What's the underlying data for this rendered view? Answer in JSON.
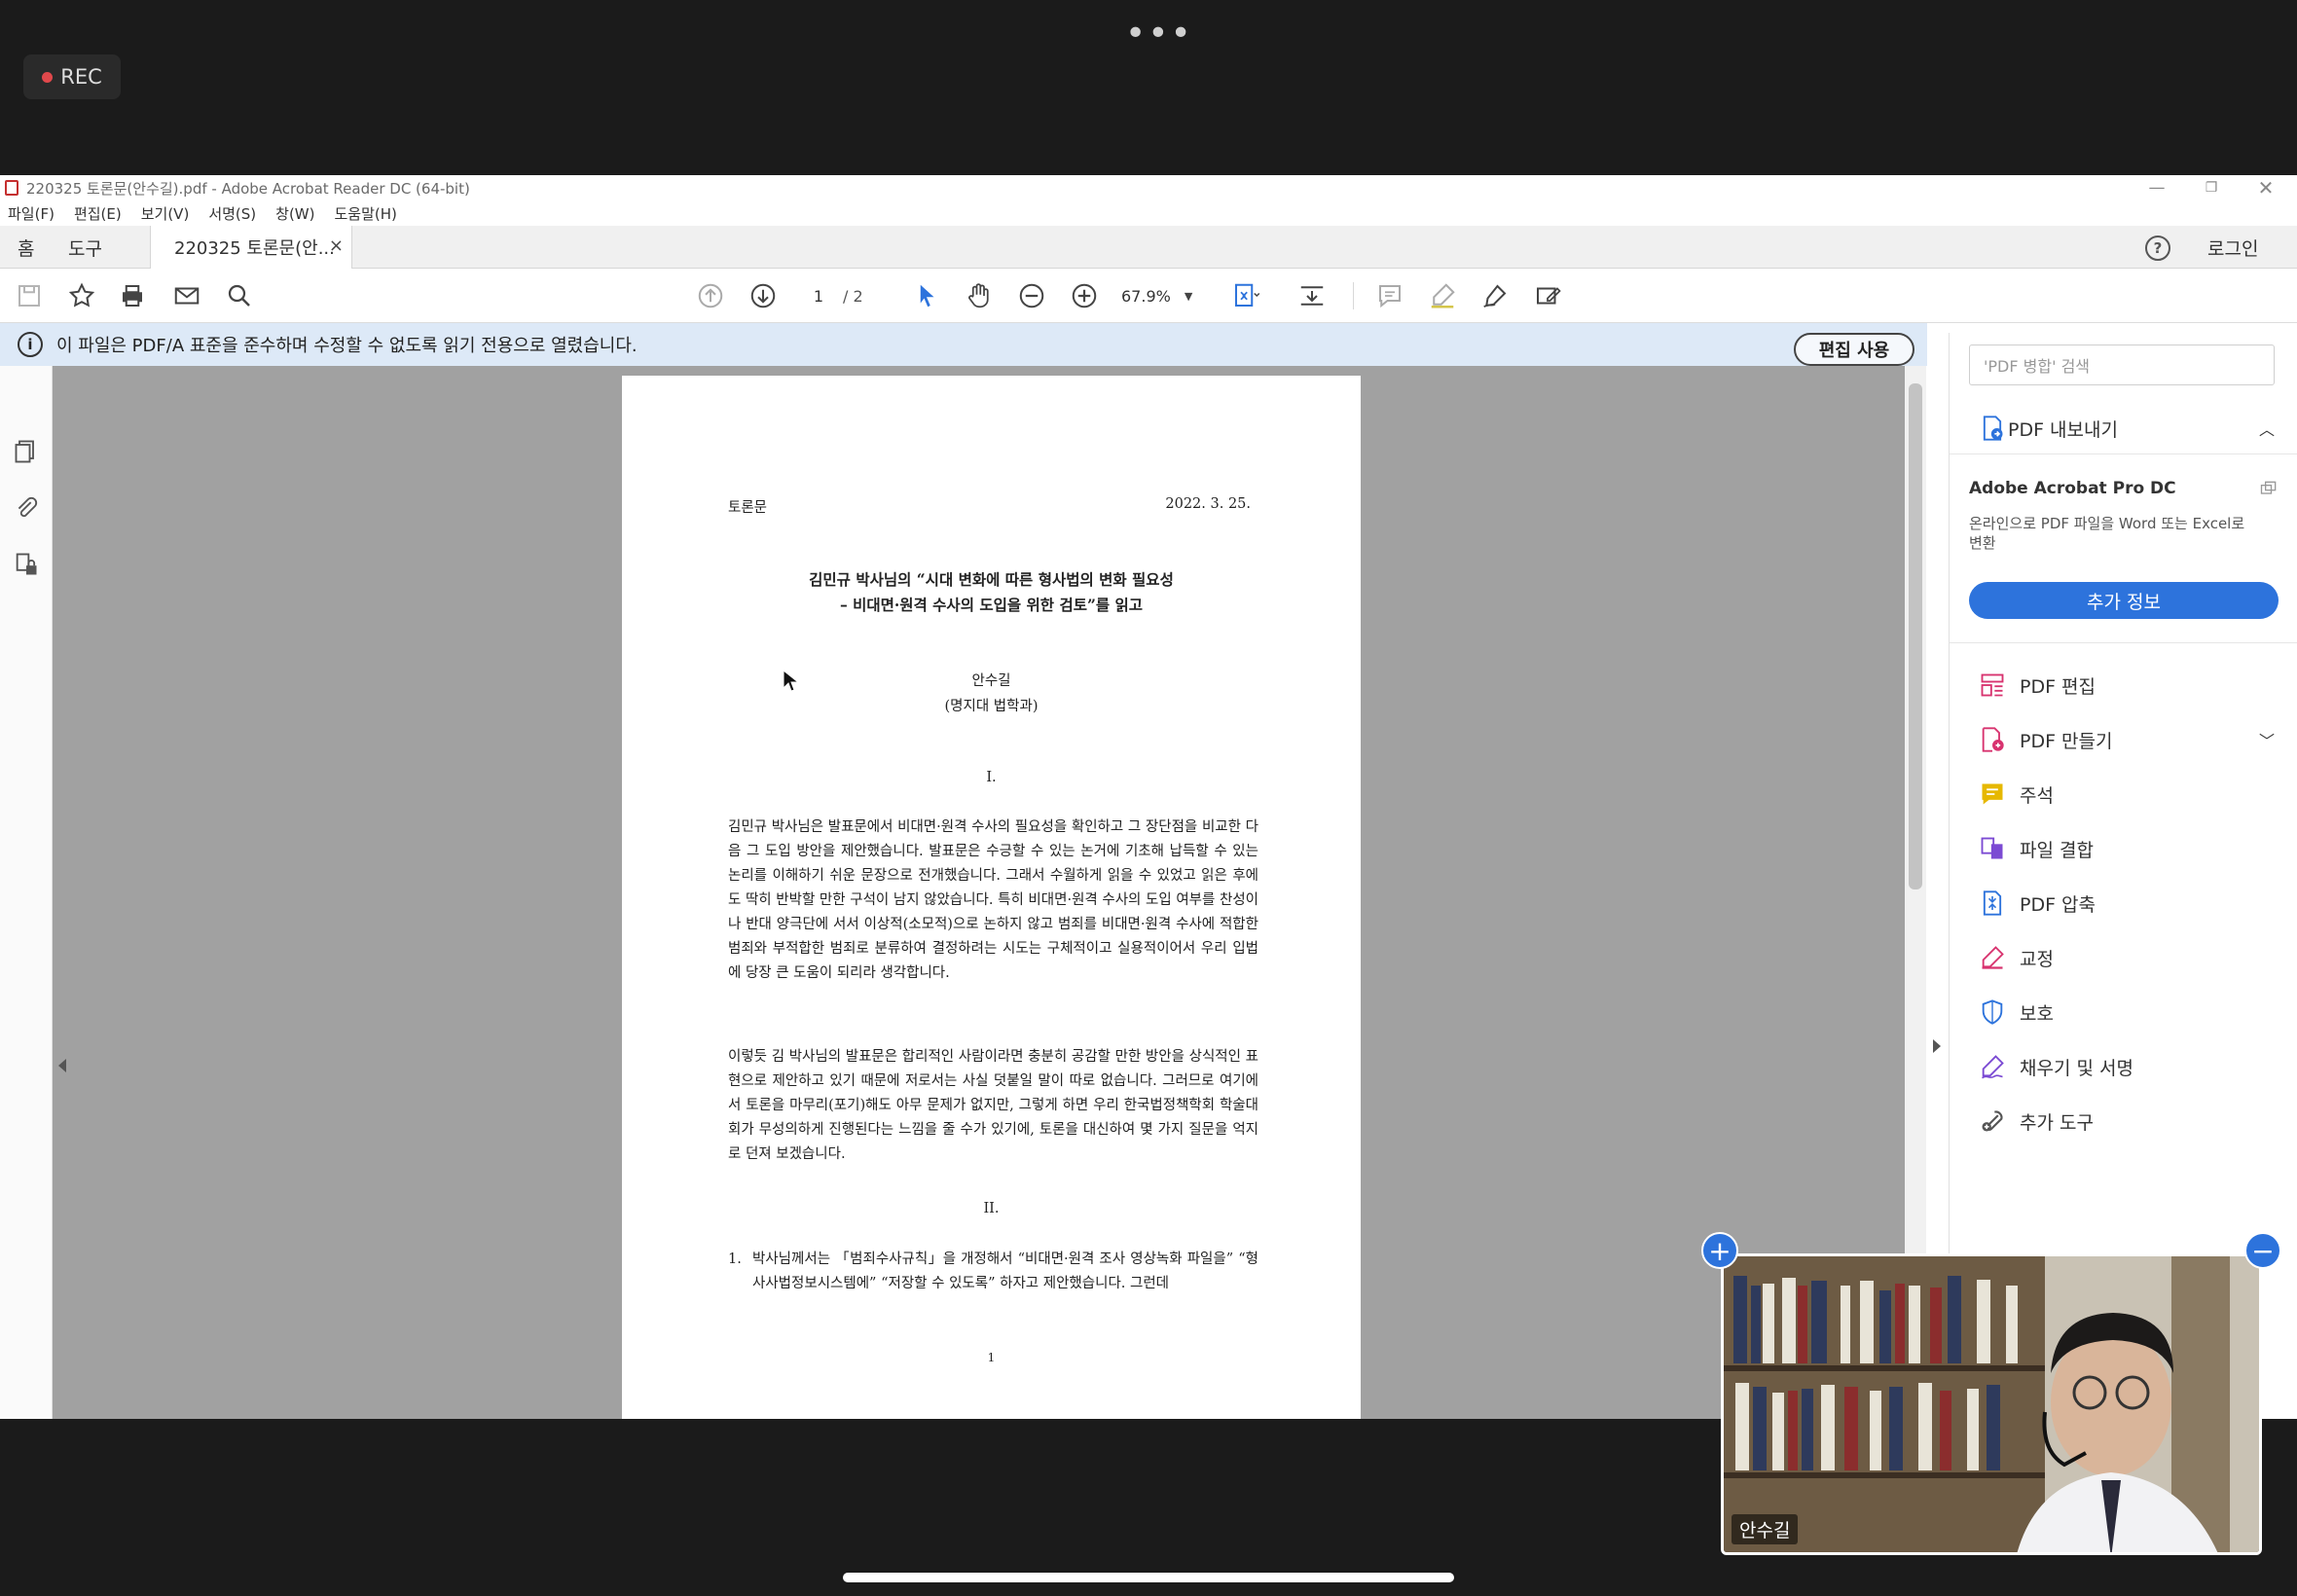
{
  "recording": {
    "label": "REC"
  },
  "window": {
    "title": "220325 토론문(안수길).pdf - Adobe Acrobat Reader DC (64-bit)"
  },
  "menu": [
    "파일(F)",
    "편집(E)",
    "보기(V)",
    "서명(S)",
    "창(W)",
    "도움말(H)"
  ],
  "nav": {
    "home": "홈",
    "tools": "도구",
    "doc_tab": "220325 토론문(안...",
    "close": "×",
    "login": "로그인"
  },
  "toolbar": {
    "page_current": "1",
    "page_total": "/ 2",
    "zoom": "67.9%"
  },
  "infobar": {
    "message": "이 파일은 PDF/A 표준을 준수하며 수정할 수 없도록 읽기 전용으로 열렸습니다.",
    "edit_button": "편집 사용"
  },
  "document": {
    "header_left": "토론문",
    "header_right": "2022. 3. 25.",
    "title_line1": "김민규 박사님의 “시대 변화에 따른 형사법의 변화 필요성",
    "title_line2": "– 비대면·원격 수사의 도입을 위한 검토”를 읽고",
    "author": "안수길",
    "affiliation": "(명지대 법학과)",
    "section1": "I.",
    "para1": "김민규 박사님은 발표문에서 비대면·원격 수사의 필요성을 확인하고 그 장단점을 비교한 다음 그 도입 방안을 제안했습니다. 발표문은 수긍할 수 있는 논거에 기초해 납득할 수 있는 논리를 이해하기 쉬운 문장으로 전개했습니다. 그래서 수월하게 읽을 수 있었고 읽은 후에도 딱히 반박할 만한 구석이 남지 않았습니다. 특히 비대면·원격 수사의 도입 여부를 찬성이나 반대 양극단에 서서 이상적(소모적)으로 논하지 않고 범죄를 비대면·원격 수사에 적합한 범죄와 부적합한 범죄로 분류하여 결정하려는 시도는 구체적이고 실용적이어서 우리 입법에 당장 큰 도움이 되리라 생각합니다.",
    "para2": "이렇듯 김 박사님의 발표문은 합리적인 사람이라면 충분히 공감할 만한 방안을 상식적인 표현으로 제안하고 있기 때문에 저로서는 사실 덧붙일 말이 따로 없습니다. 그러므로 여기에서 토론을 마무리(포기)해도 아무 문제가 없지만, 그렇게 하면 우리 한국법정책학회 학술대회가 무성의하게 진행된다는 느낌을 줄 수가 있기에, 토론을 대신하여 몇 가지 질문을 억지로 던져 보겠습니다.",
    "section2": "II.",
    "item1_num": "1.",
    "item1": "박사님께서는 「범죄수사규칙」을 개정해서 “비대면·원격 조사 영상녹화 파일을” “형사사법정보시스템에” “저장할 수 있도록” 하자고 제안했습니다. 그런데",
    "page_mark": "1"
  },
  "right_panel": {
    "search_placeholder": "'PDF 병합' 검색",
    "export": "PDF 내보내기",
    "pro_title": "Adobe Acrobat Pro DC",
    "pro_desc": "온라인으로 PDF 파일을 Word 또는 Excel로 변환",
    "pro_button": "추가 정보",
    "tools": [
      {
        "label": "PDF 편집",
        "icon": "edit-pdf-icon",
        "color": "#d8336f"
      },
      {
        "label": "PDF 만들기",
        "icon": "create-pdf-icon",
        "color": "#d8336f"
      },
      {
        "label": "주석",
        "icon": "comment-icon",
        "color": "#e6b800"
      },
      {
        "label": "파일 결합",
        "icon": "combine-files-icon",
        "color": "#7b4ad3"
      },
      {
        "label": "PDF 압축",
        "icon": "compress-pdf-icon",
        "color": "#2d73dc"
      },
      {
        "label": "교정",
        "icon": "redact-icon",
        "color": "#d8336f"
      },
      {
        "label": "보호",
        "icon": "protect-icon",
        "color": "#2d73dc"
      },
      {
        "label": "채우기 및 서명",
        "icon": "fill-sign-icon",
        "color": "#7b4ad3"
      },
      {
        "label": "추가 도구",
        "icon": "more-tools-icon",
        "color": "#555555"
      }
    ]
  },
  "video": {
    "participant": "안수길"
  },
  "colors": {
    "accent": "#2d73dc",
    "infobar": "#dde9f7",
    "canvas": "#a1a1a1"
  }
}
